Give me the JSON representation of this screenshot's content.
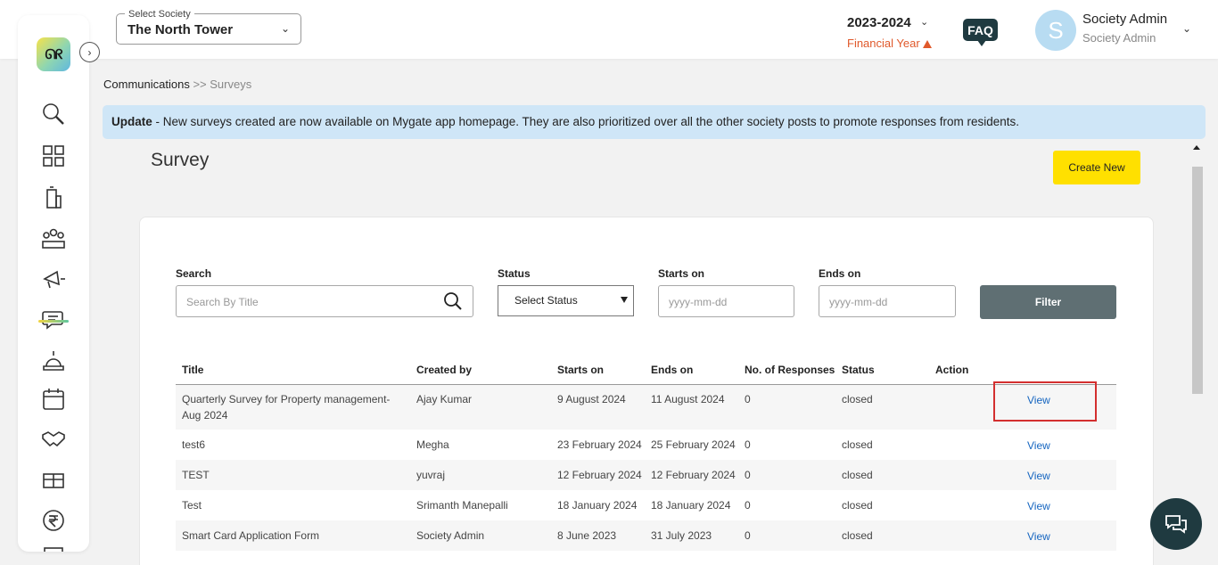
{
  "header": {
    "society_label": "Select Society",
    "society_value": "The North Tower",
    "financial_year": "2023-2024",
    "financial_year_label": "Financial Year",
    "faq": "FAQ",
    "avatar_initial": "S",
    "user_name": "Society Admin",
    "user_role": "Society Admin"
  },
  "sidebar": {
    "logo_text": "ᘏᖇ",
    "icons": [
      "search-icon",
      "dashboard-icon",
      "building-icon",
      "residents-icon",
      "megaphone-icon",
      "communications-icon",
      "amenities-icon",
      "calendar-icon",
      "handshake-icon",
      "gift-icon",
      "rupee-icon",
      "checklist-icon"
    ]
  },
  "breadcrumb": {
    "parent": "Communications",
    "separator": ">>",
    "current": "Surveys"
  },
  "banner": {
    "bold": "Update",
    "text": " - New surveys created are now available on Mygate app homepage. They are also prioritized over all the other society posts to promote responses from residents."
  },
  "page": {
    "title": "Survey",
    "create_button": "Create New"
  },
  "filters": {
    "search_label": "Search",
    "search_placeholder": "Search By Title",
    "status_label": "Status",
    "status_value": "Select Status",
    "starts_label": "Starts on",
    "starts_placeholder": "yyyy-mm-dd",
    "ends_label": "Ends on",
    "ends_placeholder": "yyyy-mm-dd",
    "filter_button": "Filter"
  },
  "table": {
    "headers": [
      "Title",
      "Created by",
      "Starts on",
      "Ends on",
      "No. of Responses",
      "Status",
      "Action"
    ],
    "rows": [
      {
        "title": "Quarterly Survey for Property management-Aug 2024",
        "created_by": "Ajay Kumar",
        "starts_on": "9 August 2024",
        "ends_on": "11 August 2024",
        "responses": "0",
        "status": "closed",
        "action": "View"
      },
      {
        "title": "test6",
        "created_by": "Megha",
        "starts_on": "23 February 2024",
        "ends_on": "25 February 2024",
        "responses": "0",
        "status": "closed",
        "action": "View"
      },
      {
        "title": "TEST",
        "created_by": "yuvraj",
        "starts_on": "12 February 2024",
        "ends_on": "12 February 2024",
        "responses": "0",
        "status": "closed",
        "action": "View"
      },
      {
        "title": "Test",
        "created_by": "Srimanth Manepalli",
        "starts_on": "18 January 2024",
        "ends_on": "18 January 2024",
        "responses": "0",
        "status": "closed",
        "action": "View"
      },
      {
        "title": "Smart Card Application Form",
        "created_by": "Society Admin",
        "starts_on": "8 June 2023",
        "ends_on": "31 July 2023",
        "responses": "0",
        "status": "closed",
        "action": "View"
      }
    ]
  },
  "colors": {
    "accent_yellow": "#ffe000",
    "banner_bg": "#cfe6f7",
    "dark_teal": "#1f3a40",
    "link": "#1565c0",
    "highlight": "#d32f2f",
    "warning": "#e0592b"
  }
}
